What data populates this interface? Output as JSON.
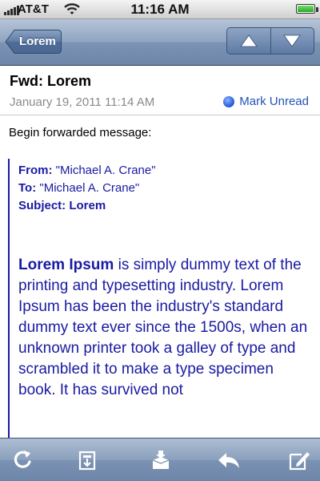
{
  "status_bar": {
    "carrier": "AT&T",
    "time": "11:16 AM",
    "battery_level": 1.0
  },
  "nav": {
    "back_label": "Lorem",
    "icons": [
      "up-arrow-icon",
      "down-arrow-icon"
    ]
  },
  "message": {
    "subject": "Fwd: Lorem",
    "date": "January 19, 2011 11:14 AM",
    "mark_unread_label": "Mark Unread",
    "intro": "Begin forwarded message:",
    "forwarded": {
      "from_label": "From:",
      "from_value": "\"Michael A. Crane\"",
      "to_label": "To:",
      "to_value": "\"Michael A. Crane\"",
      "subject_label": "Subject:",
      "subject_value": "Lorem"
    },
    "body_lead": "Lorem Ipsum",
    "body_text": " is simply dummy text of the printing and typesetting industry. Lorem Ipsum has been the industry's standard dummy text ever since the 1500s, when an unknown printer took a galley of type and scrambled it to make a type specimen book. It has survived not"
  },
  "toolbar": {
    "icons": [
      "refresh-icon",
      "move-to-folder-icon",
      "delete-icon",
      "reply-icon",
      "compose-icon"
    ]
  },
  "colors": {
    "quote": "#1a1aa3",
    "link": "#2352b7",
    "nav": "#7b93b4"
  }
}
